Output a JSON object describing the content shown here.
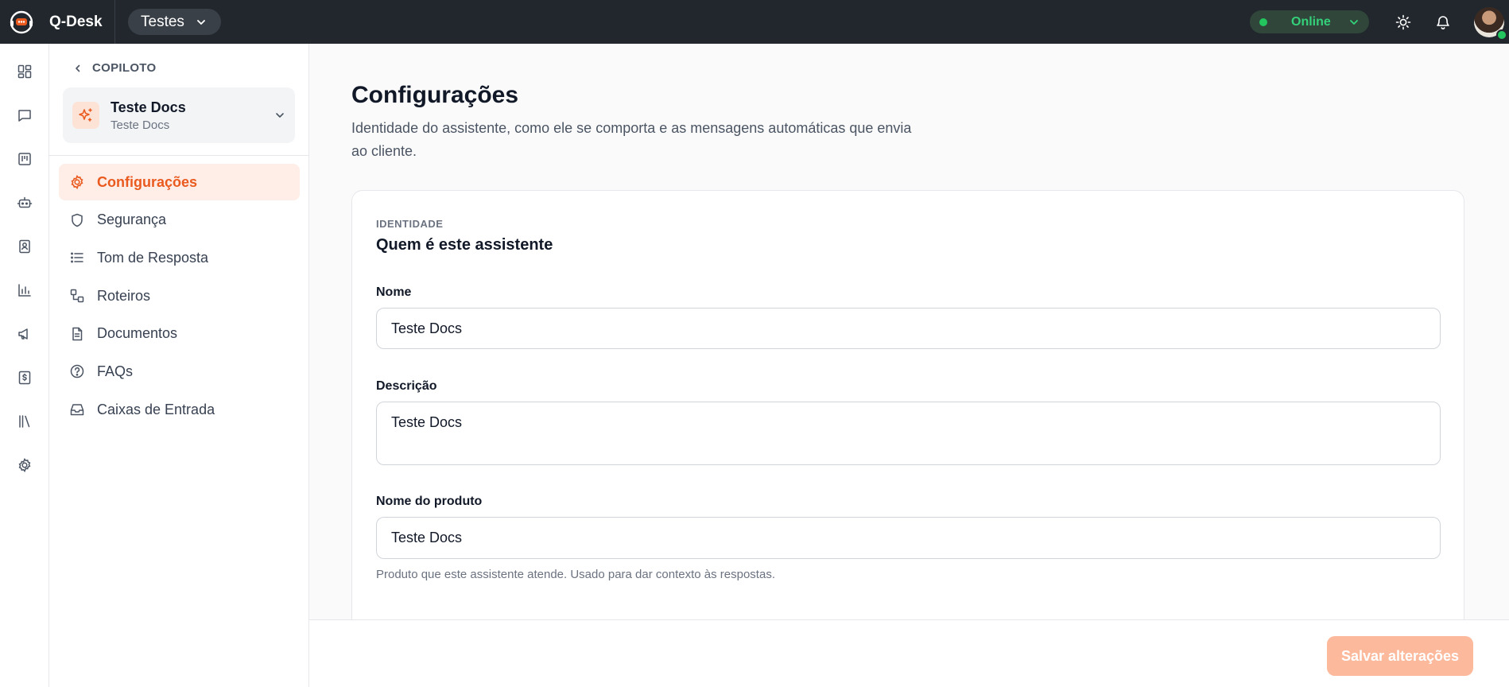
{
  "topbar": {
    "app_name": "Q-Desk",
    "workspace": "Testes",
    "status": "Online"
  },
  "rail": {
    "items": [
      "dashboard-icon",
      "chat-icon",
      "kanban-icon",
      "bot-icon",
      "contacts-icon",
      "reports-icon",
      "campaigns-icon",
      "billing-icon",
      "library-icon",
      "settings-icon"
    ]
  },
  "sidebar": {
    "back_label": "COPILOTO",
    "assistant": {
      "name": "Teste Docs",
      "subtitle": "Teste Docs"
    },
    "items": [
      {
        "label": "Configurações",
        "icon": "gear-icon",
        "active": true
      },
      {
        "label": "Segurança",
        "icon": "shield-icon"
      },
      {
        "label": "Tom de Resposta",
        "icon": "list-icon"
      },
      {
        "label": "Roteiros",
        "icon": "workflow-icon"
      },
      {
        "label": "Documentos",
        "icon": "document-icon"
      },
      {
        "label": "FAQs",
        "icon": "help-circle-icon"
      },
      {
        "label": "Caixas de Entrada",
        "icon": "inbox-icon"
      }
    ]
  },
  "main": {
    "title": "Configurações",
    "description": "Identidade do assistente, como ele se comporta e as mensagens automáticas que envia ao cliente.",
    "section": {
      "label": "IDENTIDADE",
      "title": "Quem é este assistente"
    },
    "fields": {
      "name": {
        "label": "Nome",
        "value": "Teste Docs"
      },
      "description": {
        "label": "Descrição",
        "value": "Teste Docs"
      },
      "product": {
        "label": "Nome do produto",
        "value": "Teste Docs",
        "hint": "Produto que este assistente atende. Usado para dar contexto às respostas."
      }
    },
    "save_label": "Salvar alterações"
  },
  "colors": {
    "accent": "#ea5a1f",
    "accent_soft": "#feeee7",
    "topbar": "#22272d",
    "online": "#22c55e",
    "save_disabled": "#fdb99c"
  }
}
